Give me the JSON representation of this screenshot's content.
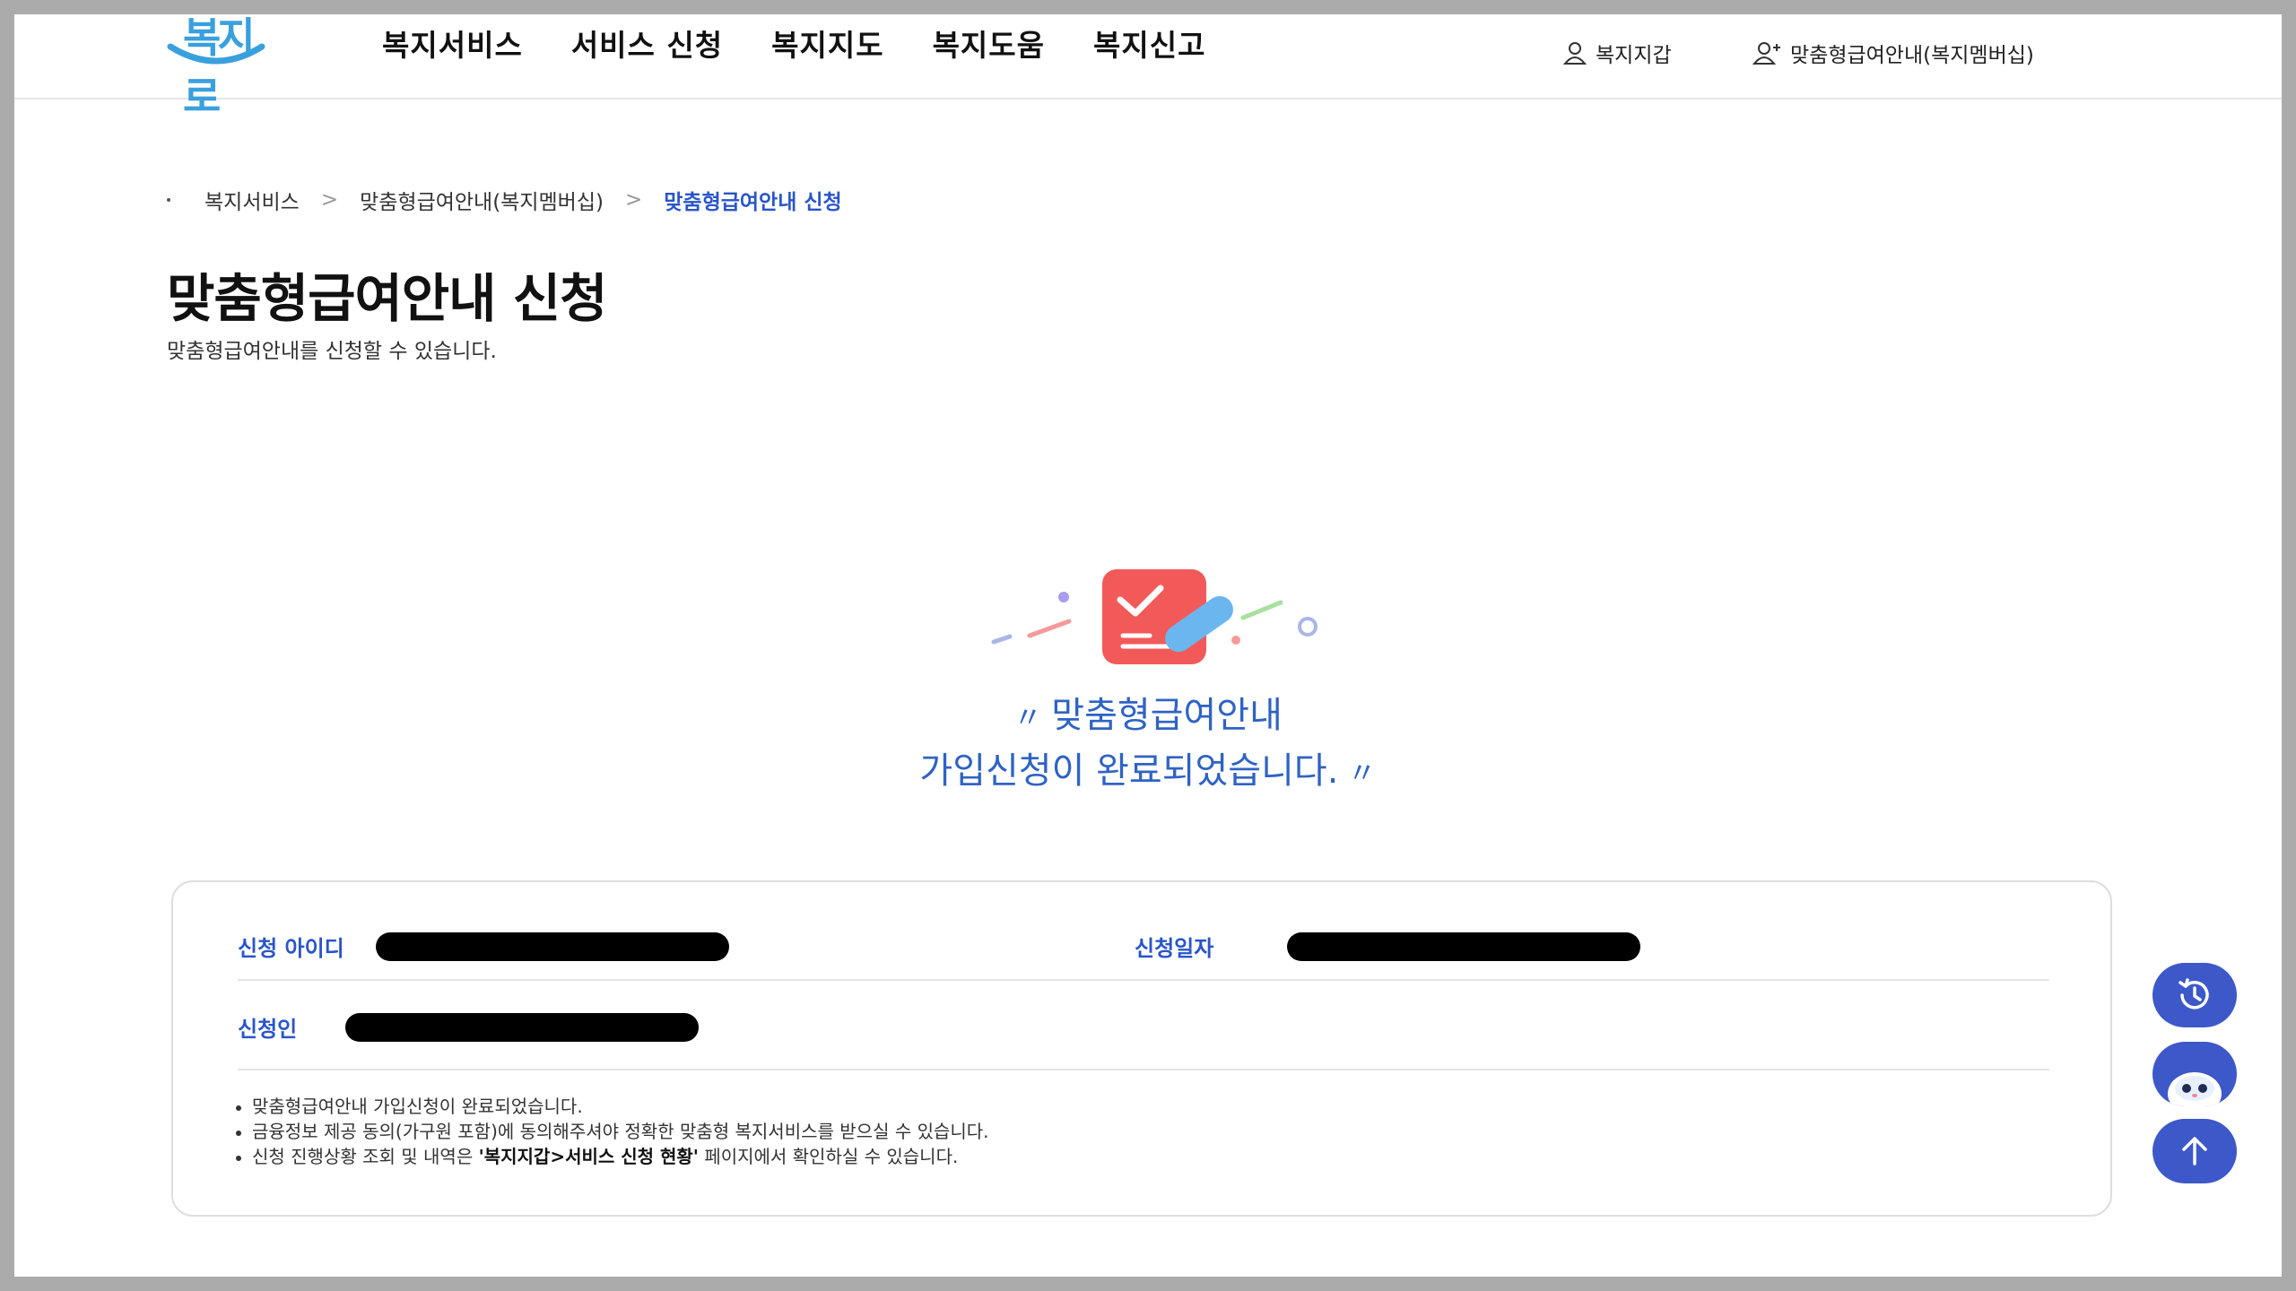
{
  "header": {
    "logo_text": "복지로",
    "nav": [
      "복지서비스",
      "서비스 신청",
      "복지지도",
      "복지도움",
      "복지신고"
    ],
    "wallet_label": "복지지갑",
    "membership_label": "맞춤형급여안내(복지멤버십)"
  },
  "breadcrumb": {
    "items": [
      "복지서비스",
      "맞춤형급여안내(복지멤버십)",
      "맞춤형급여안내 신청"
    ]
  },
  "page": {
    "title": "맞춤형급여안내 신청",
    "description": "맞춤형급여안내를 신청할 수 있습니다."
  },
  "result": {
    "line1": "맞춤형급여안내",
    "line2": "가입신청이 완료되었습니다."
  },
  "info": {
    "applicant_id_label": "신청 아이디",
    "apply_date_label": "신청일자",
    "applicant_label": "신청인",
    "notes": {
      "n1": "맞춤형급여안내 가입신청이 완료되었습니다.",
      "n2": "금융정보 제공 동의(가구원 포함)에 동의해주셔야 정확한 맞춤형 복지서비스를 받으실 수 있습니다.",
      "n3_prefix": "신청 진행상황 조회 및 내역은 ",
      "n3_bold": "'복지지갑>서비스 신청 현황'",
      "n3_suffix": " 페이지에서 확인하실 수 있습니다."
    }
  },
  "colors": {
    "accent": "#2a55c9",
    "message": "#2f63c4",
    "fab": "#3d58c8",
    "logo": "#3aa0dd"
  },
  "icons": {
    "wallet": "person-icon",
    "membership": "person-add-icon",
    "history": "history-icon",
    "chatbot": "chatbot-icon",
    "top": "arrow-up-icon"
  }
}
